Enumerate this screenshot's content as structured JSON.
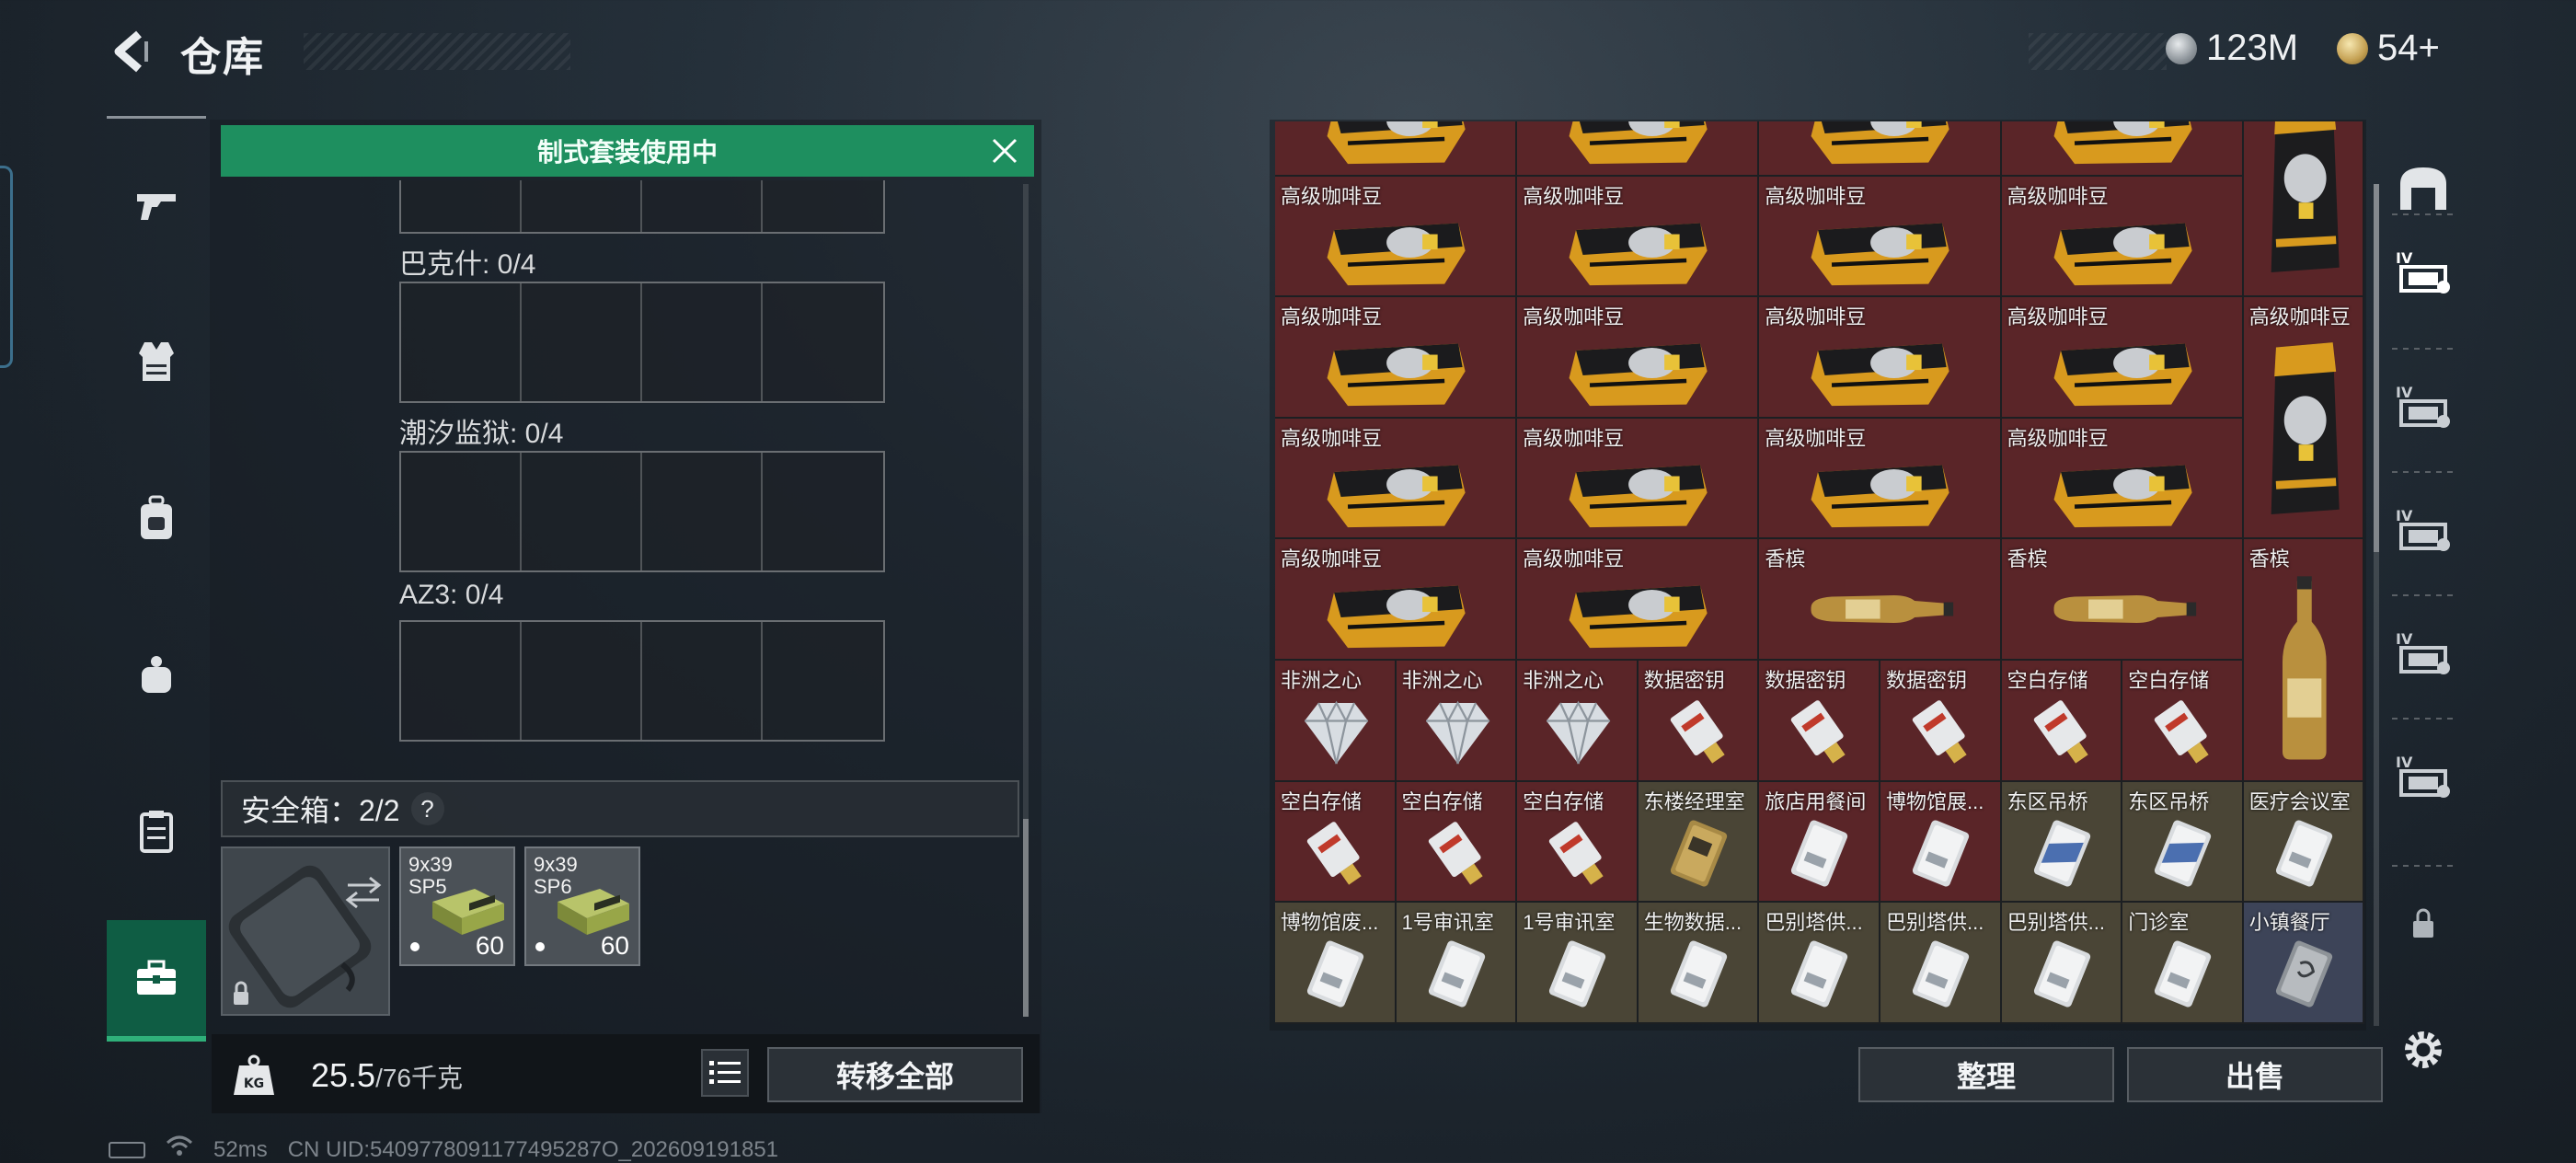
{
  "header": {
    "title": "仓库",
    "currencies": [
      {
        "icon": "silver-coin-icon",
        "value": "123M"
      },
      {
        "icon": "gold-token-icon",
        "value": "54+"
      }
    ]
  },
  "left_nav": [
    {
      "icon": "gun-icon",
      "active": false
    },
    {
      "icon": "vest-icon",
      "active": false
    },
    {
      "icon": "backpack-icon",
      "active": false
    },
    {
      "icon": "pouch-icon",
      "active": false
    },
    {
      "icon": "clipboard-icon",
      "active": false
    },
    {
      "icon": "toolbox-icon",
      "active": true
    }
  ],
  "banner": {
    "text": "制式套装使用中"
  },
  "key_groups": [
    {
      "label": "巴克什: 0/4"
    },
    {
      "label": "潮汐监狱: 0/4"
    },
    {
      "label": "AZ3: 0/4"
    }
  ],
  "safebox": {
    "label": "安全箱：2/2",
    "help": "?",
    "ammo": [
      {
        "name": "9x39\nSP5",
        "qty": "60"
      },
      {
        "name": "9x39\nSP6",
        "qty": "60"
      }
    ]
  },
  "weight": {
    "current": "25.5",
    "max": "/76千克",
    "icon_label": "KG"
  },
  "buttons": {
    "transfer_all": "转移全部",
    "organize": "整理",
    "sell": "出售"
  },
  "grid_items": [
    {
      "label": "",
      "item": "coffee",
      "bg": "red"
    },
    {
      "label": "",
      "item": "coffee",
      "bg": "red"
    },
    {
      "label": "",
      "item": "coffee",
      "bg": "red"
    },
    {
      "label": "",
      "item": "coffee",
      "bg": "red"
    },
    {
      "label": "",
      "item": "coffee-tall",
      "bg": "red"
    },
    {
      "label": "高级咖啡豆",
      "item": "coffee",
      "bg": "red"
    },
    {
      "label": "高级咖啡豆",
      "item": "coffee",
      "bg": "red"
    },
    {
      "label": "高级咖啡豆",
      "item": "coffee",
      "bg": "red"
    },
    {
      "label": "高级咖啡豆",
      "item": "coffee",
      "bg": "red"
    },
    {
      "label": "高级咖啡豆",
      "item": "coffee",
      "bg": "red"
    },
    {
      "label": "高级咖啡豆",
      "item": "coffee",
      "bg": "red"
    },
    {
      "label": "高级咖啡豆",
      "item": "coffee",
      "bg": "red"
    },
    {
      "label": "高级咖啡豆",
      "item": "coffee",
      "bg": "red"
    },
    {
      "label": "高级咖啡豆",
      "item": "coffee-tall",
      "bg": "red"
    },
    {
      "label": "高级咖啡豆",
      "item": "coffee",
      "bg": "red"
    },
    {
      "label": "高级咖啡豆",
      "item": "coffee",
      "bg": "red"
    },
    {
      "label": "高级咖啡豆",
      "item": "coffee",
      "bg": "red"
    },
    {
      "label": "高级咖啡豆",
      "item": "coffee",
      "bg": "red"
    },
    {
      "label": "高级咖啡豆",
      "item": "coffee",
      "bg": "red"
    },
    {
      "label": "高级咖啡豆",
      "item": "coffee",
      "bg": "red"
    },
    {
      "label": "香槟",
      "item": "champagne",
      "bg": "red"
    },
    {
      "label": "香槟",
      "item": "champagne",
      "bg": "red"
    },
    {
      "label": "香槟",
      "item": "champagne-tall",
      "bg": "red"
    },
    {
      "label": "非洲之心",
      "item": "diamond",
      "bg": "red"
    },
    {
      "label": "非洲之心",
      "item": "diamond",
      "bg": "red"
    },
    {
      "label": "非洲之心",
      "item": "diamond",
      "bg": "red"
    },
    {
      "label": "数据密钥",
      "item": "usb",
      "bg": "red"
    },
    {
      "label": "数据密钥",
      "item": "usb",
      "bg": "red"
    },
    {
      "label": "数据密钥",
      "item": "usb",
      "bg": "red"
    },
    {
      "label": "空白存储",
      "item": "usb",
      "bg": "red"
    },
    {
      "label": "空白存储",
      "item": "usb",
      "bg": "red"
    },
    {
      "label": "空白存储",
      "item": "usb",
      "bg": "red"
    },
    {
      "label": "空白存储",
      "item": "usb",
      "bg": "red"
    },
    {
      "label": "空白存储",
      "item": "usb",
      "bg": "red"
    },
    {
      "label": "东楼经理室",
      "item": "keycard-gold",
      "bg": "olive"
    },
    {
      "label": "旅店用餐间",
      "item": "keycard",
      "bg": "red"
    },
    {
      "label": "博物馆展...",
      "item": "keycard",
      "bg": "red"
    },
    {
      "label": "东区吊桥",
      "item": "keycard-blue",
      "bg": "olive"
    },
    {
      "label": "东区吊桥",
      "item": "keycard-blue",
      "bg": "olive"
    },
    {
      "label": "医疗会议室",
      "item": "keycard",
      "bg": "olive"
    },
    {
      "label": "博物馆废...",
      "item": "keycard",
      "bg": "olive"
    },
    {
      "label": "1号审讯室",
      "item": "keycard",
      "bg": "olive"
    },
    {
      "label": "1号审讯室",
      "item": "keycard",
      "bg": "olive"
    },
    {
      "label": "生物数据...",
      "item": "keycard",
      "bg": "olive"
    },
    {
      "label": "巴别塔供...",
      "item": "keycard",
      "bg": "olive"
    },
    {
      "label": "巴别塔供...",
      "item": "keycard",
      "bg": "olive"
    },
    {
      "label": "巴别塔供...",
      "item": "keycard",
      "bg": "olive"
    },
    {
      "label": "门诊室",
      "item": "keycard",
      "bg": "olive"
    },
    {
      "label": "小镇餐厅",
      "item": "keycard-gray",
      "bg": "blue"
    }
  ],
  "right_tabs": [
    {
      "icon": "storage-icon"
    },
    {
      "icon": "warehouse-iv-icon"
    },
    {
      "icon": "warehouse-iv-icon"
    },
    {
      "icon": "warehouse-iv-icon"
    },
    {
      "icon": "warehouse-iv-icon"
    },
    {
      "icon": "warehouse-iv-icon"
    },
    {
      "icon": "lock-icon"
    },
    {
      "icon": "gear-icon"
    }
  ],
  "footer": {
    "ping": "52ms",
    "uid": "CN UID:5409778091177495287O_202609191851"
  },
  "colors": {
    "accent_green": "#1e8f5f",
    "cell_red": "#5a2528",
    "cell_olive": "#4a4536"
  }
}
